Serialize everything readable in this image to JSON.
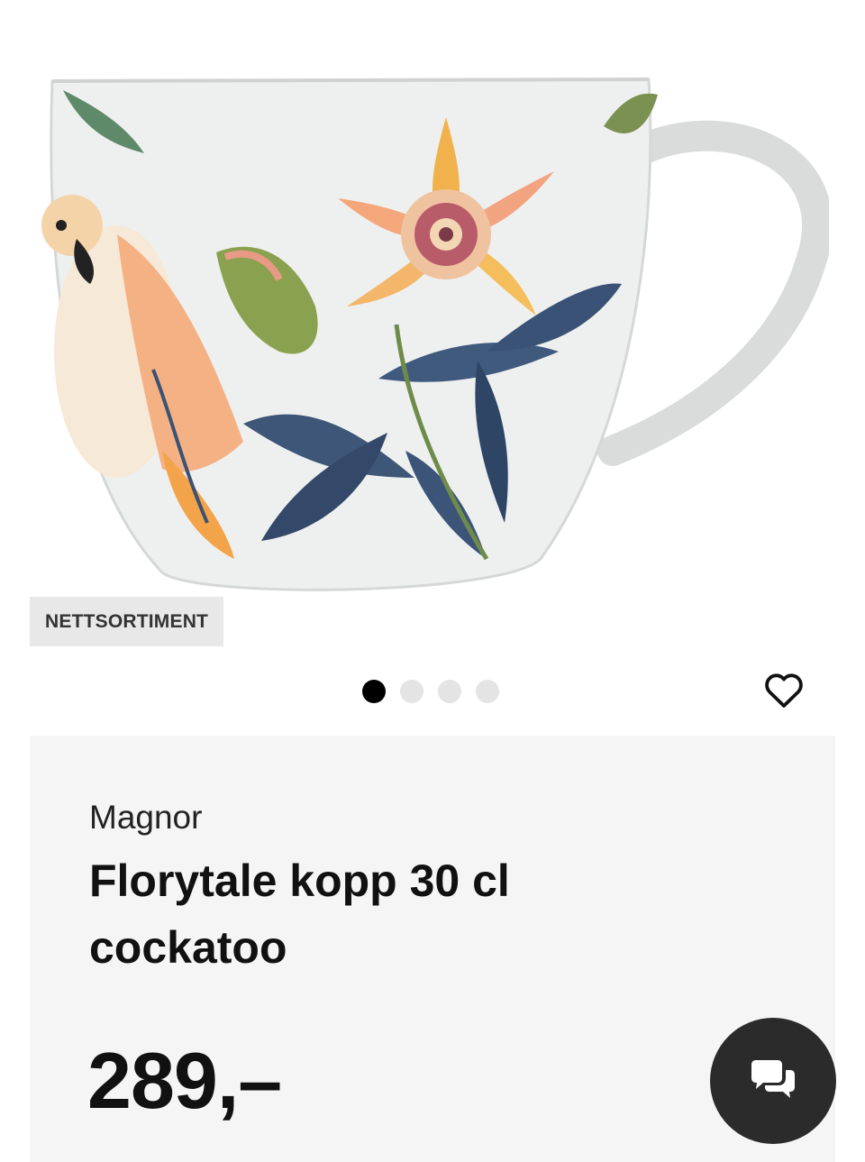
{
  "product": {
    "badge": "NETTSORTIMENT",
    "brand": "Magnor",
    "title": "Florytale kopp 30 cl cockatoo",
    "price": "289,–"
  },
  "carousel": {
    "total": 4,
    "active_index": 0
  },
  "icons": {
    "wishlist": "heart-icon",
    "chat": "chat-bubbles-icon"
  },
  "colors": {
    "panel_bg": "#f5f5f5",
    "badge_bg": "#e8e8e8",
    "dot_active": "#000000",
    "dot_inactive": "#e4e4e4",
    "chat_bg": "#2b2b2b"
  }
}
